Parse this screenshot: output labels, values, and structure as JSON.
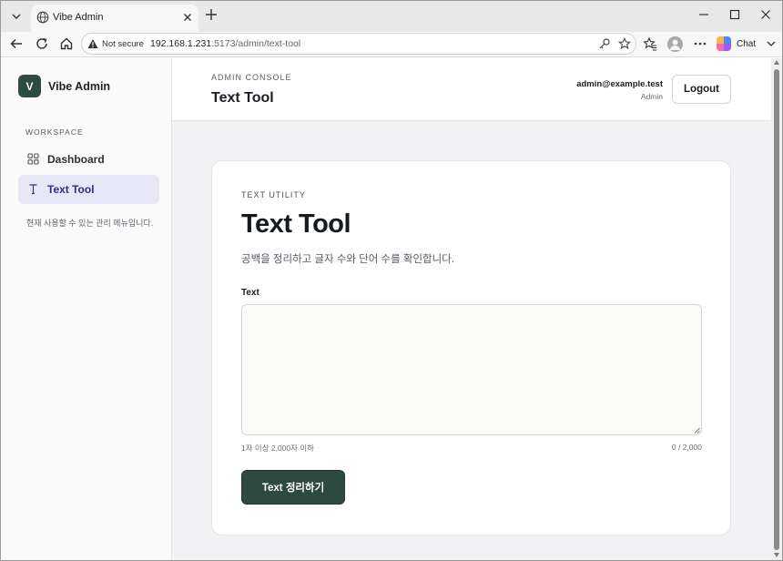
{
  "browser": {
    "tab_title": "Vibe Admin",
    "not_secure_label": "Not secure",
    "url_host": "192.168.1.231",
    "url_rest": ":5173/admin/text-tool",
    "chat_label": "Chat"
  },
  "sidebar": {
    "logo_letter": "V",
    "brand_name": "Vibe Admin",
    "section_label": "WORKSPACE",
    "items": [
      {
        "label": "Dashboard",
        "icon": "grid-icon",
        "active": false
      },
      {
        "label": "Text Tool",
        "icon": "text-cursor-icon",
        "active": true
      }
    ],
    "note": "현재 사용할 수 있는 관리 메뉴입니다."
  },
  "header": {
    "eyebrow": "ADMIN CONSOLE",
    "title": "Text Tool",
    "user_email": "admin@example.test",
    "user_role": "Admin",
    "logout_label": "Logout"
  },
  "card": {
    "eyebrow": "TEXT UTILITY",
    "heading": "Text Tool",
    "description": "공백을 정리하고 글자 수와 단어 수를 확인합니다.",
    "field_label": "Text",
    "textarea_value": "",
    "hint": "1자 이상 2,000자 이하",
    "counter": "0 / 2,000",
    "submit_label": "Text 정리하기"
  },
  "colors": {
    "brand": "#2f4a40",
    "active_nav_bg": "#e8e7f7",
    "page_bg": "#f2f2f4"
  }
}
